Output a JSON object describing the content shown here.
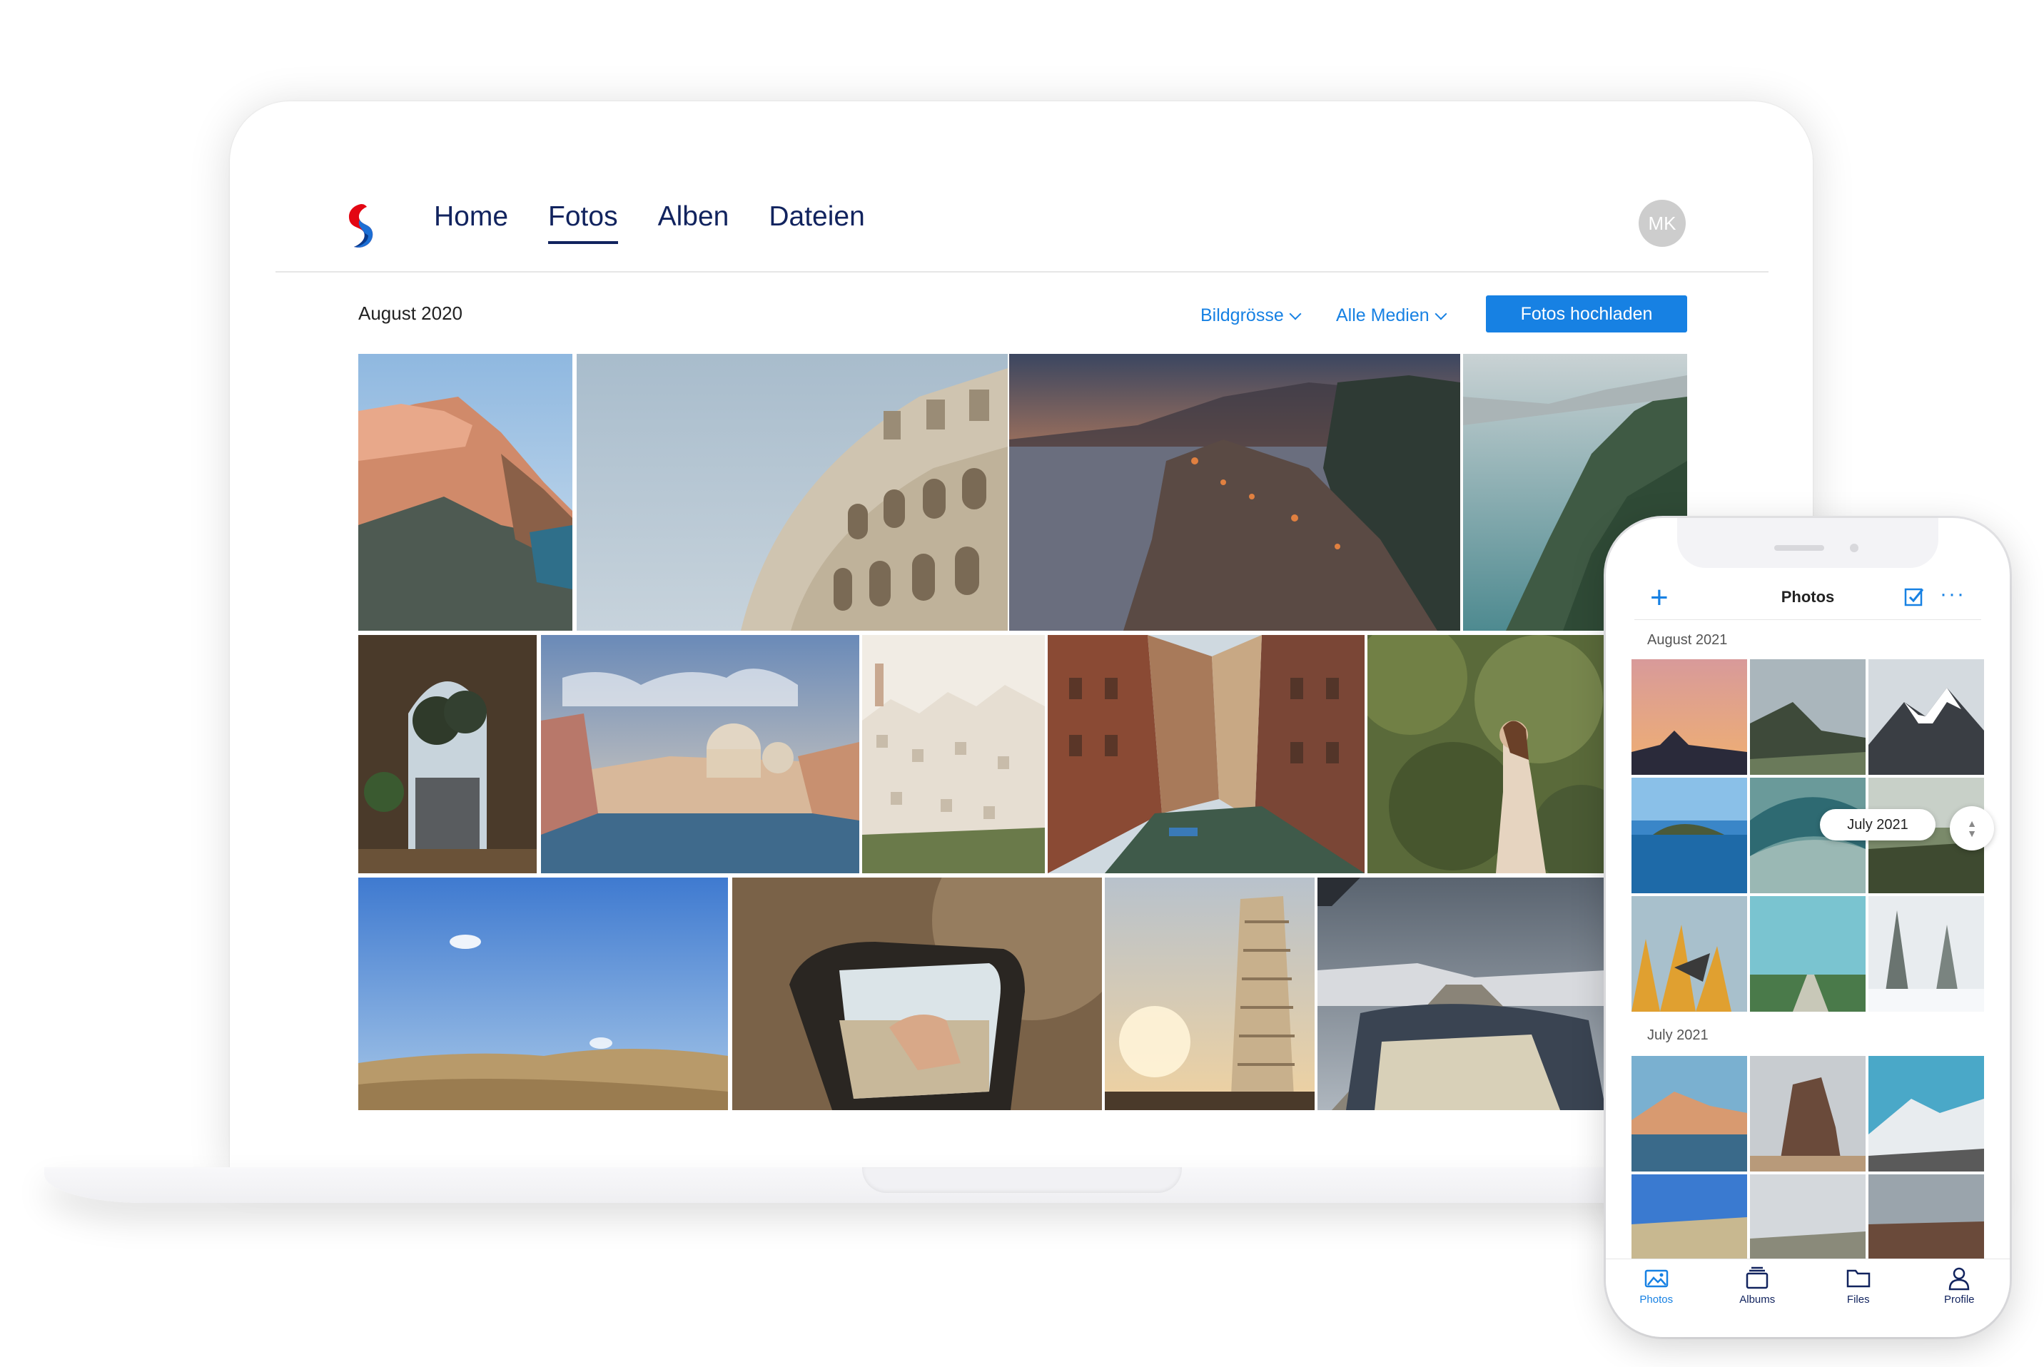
{
  "desktop": {
    "nav": [
      "Home",
      "Fotos",
      "Alben",
      "Dateien"
    ],
    "active_nav": "Fotos",
    "avatar_initials": "MK",
    "section_title": "August 2020",
    "filters": {
      "size": "Bildgrösse",
      "media": "Alle Medien"
    },
    "upload_label": "Fotos hochladen"
  },
  "mobile": {
    "title": "Photos",
    "sections": [
      "August 2021",
      "July 2021"
    ],
    "scroll_pill": "July 2021",
    "tabs": [
      "Photos",
      "Albums",
      "Files",
      "Profile"
    ]
  },
  "colors": {
    "accent": "#1781e3",
    "navy": "#11235e",
    "logo_red": "#e30613"
  },
  "icons": [
    "swisscom-logo",
    "plus-icon",
    "checkbox-icon",
    "more-icon",
    "chevron-down-icon",
    "photos-icon",
    "albums-icon",
    "files-icon",
    "profile-icon"
  ]
}
